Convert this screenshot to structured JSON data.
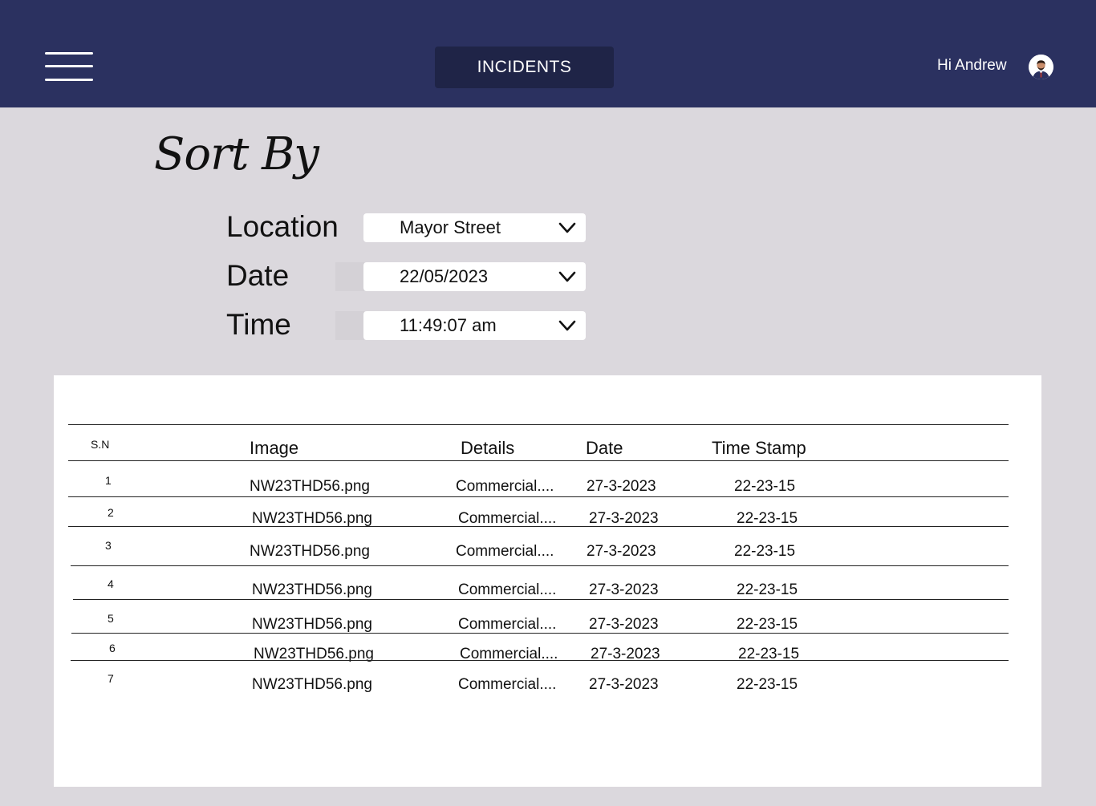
{
  "header": {
    "title": "INCIDENTS",
    "greeting": "Hi Andrew"
  },
  "sort": {
    "title": "Sort By",
    "filters": [
      {
        "label": "Location",
        "value": "Mayor Street"
      },
      {
        "label": "Date",
        "value": "22/05/2023"
      },
      {
        "label": "Time",
        "value": "11:49:07 am"
      }
    ]
  },
  "table": {
    "columns": [
      "S.N",
      "Image",
      "Details",
      "Date",
      "Time Stamp"
    ],
    "rows": [
      [
        "1",
        "NW23THD56.png",
        "Commercial....",
        "27-3-2023",
        "22-23-15"
      ],
      [
        "2",
        "NW23THD56.png",
        "Commercial....",
        "27-3-2023",
        "22-23-15"
      ],
      [
        "3",
        "NW23THD56.png",
        "Commercial....",
        "27-3-2023",
        "22-23-15"
      ],
      [
        "4",
        "NW23THD56.png",
        "Commercial....",
        "27-3-2023",
        "22-23-15"
      ],
      [
        "5",
        "NW23THD56.png",
        "Commercial....",
        "27-3-2023",
        "22-23-15"
      ],
      [
        "6",
        "NW23THD56.png",
        "Commercial....",
        "27-3-2023",
        "22-23-15"
      ],
      [
        "7",
        "NW23THD56.png",
        "Commercial....",
        "27-3-2023",
        "22-23-15"
      ]
    ]
  },
  "colors": {
    "header_bg": "#2b3160",
    "title_pill_bg": "#1f2447",
    "page_bg": "#dbd8dd"
  },
  "icons": {
    "menu": "hamburger-menu-icon",
    "avatar": "user-avatar-icon",
    "dropdown": "chevron-down-icon"
  }
}
